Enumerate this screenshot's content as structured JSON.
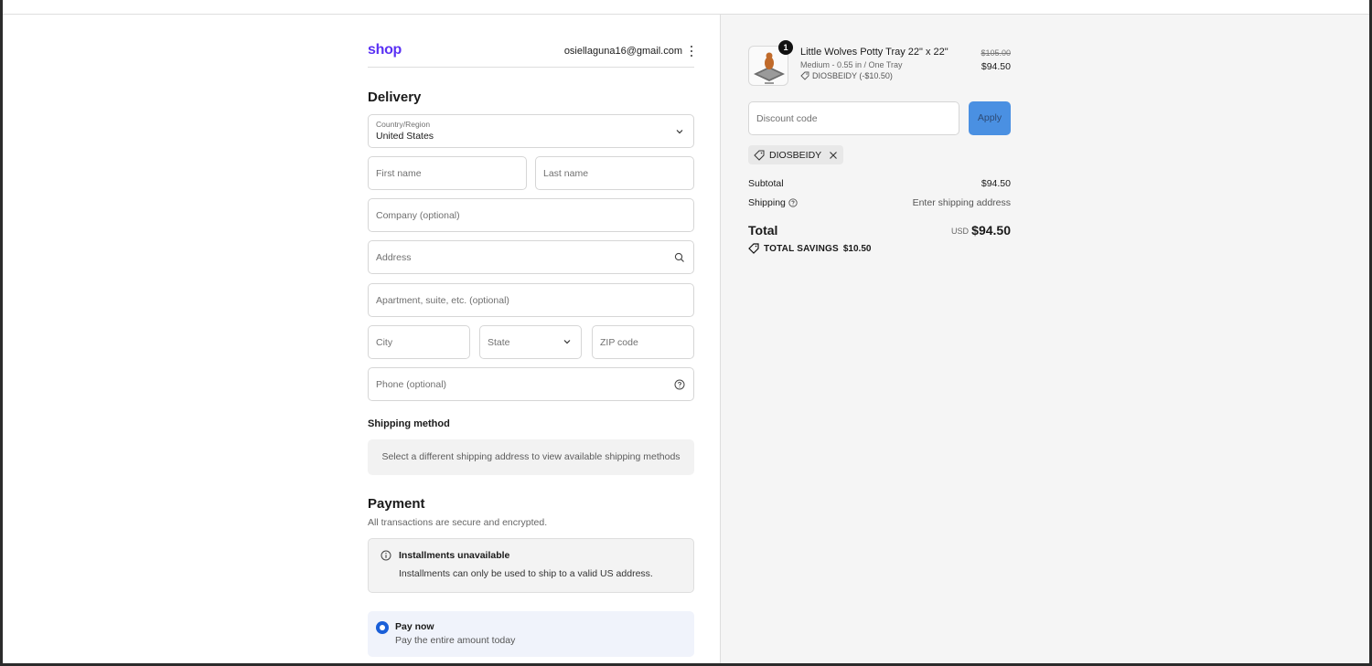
{
  "header": {
    "logo": "shop",
    "email": "osiellaguna16@gmail.com"
  },
  "delivery": {
    "title": "Delivery",
    "country_label": "Country/Region",
    "country_value": "United States",
    "first_name_placeholder": "First name",
    "last_name_placeholder": "Last name",
    "company_placeholder": "Company (optional)",
    "address_placeholder": "Address",
    "apartment_placeholder": "Apartment, suite, etc. (optional)",
    "city_placeholder": "City",
    "state_placeholder": "State",
    "zip_placeholder": "ZIP code",
    "phone_placeholder": "Phone (optional)"
  },
  "shipping": {
    "title": "Shipping method",
    "message": "Select a different shipping address to view available shipping methods"
  },
  "payment": {
    "title": "Payment",
    "subtitle": "All transactions are secure and encrypted.",
    "installments_title": "Installments unavailable",
    "installments_text": "Installments can only be used to ship to a valid US address.",
    "pay_now_title": "Pay now",
    "pay_now_text": "Pay the entire amount today"
  },
  "summary": {
    "product": {
      "quantity": "1",
      "name": "Little Wolves Potty Tray 22\" x 22\"",
      "variant": "Medium - 0.55 in / One Tray",
      "discount": "DIOSBEIDY (-$10.50)",
      "old_price": "$105.00",
      "price": "$94.50"
    },
    "discount_placeholder": "Discount code",
    "apply_label": "Apply",
    "applied_code": "DIOSBEIDY",
    "subtotal_label": "Subtotal",
    "subtotal_value": "$94.50",
    "shipping_label": "Shipping",
    "shipping_value": "Enter shipping address",
    "total_label": "Total",
    "currency": "USD",
    "total_value": "$94.50",
    "savings_label": "TOTAL SAVINGS",
    "savings_value": "$10.50"
  },
  "colors": {
    "brand": "#5a31f4",
    "apply_button": "#4a90e2",
    "radio_selected": "#1a5fd8",
    "summary_bg": "#f5f5f5"
  }
}
